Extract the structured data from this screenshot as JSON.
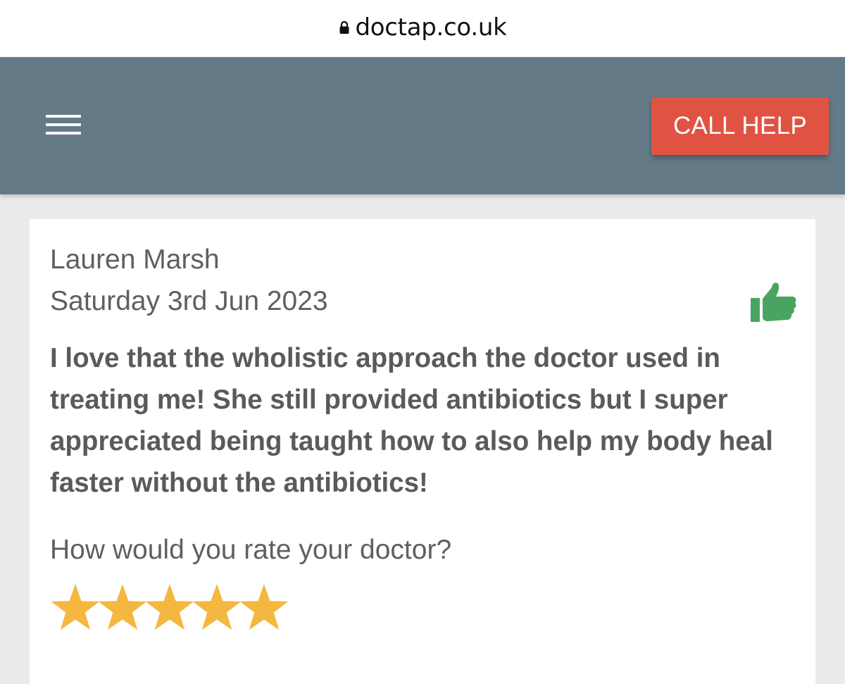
{
  "browser": {
    "url": "doctap.co.uk",
    "lock_icon": "lock-icon"
  },
  "header": {
    "menu_icon": "hamburger-menu-icon",
    "call_help_label": "CALL HELP",
    "background_color": "#647b87",
    "button_color": "#e05343"
  },
  "review": {
    "reviewer_name": "Lauren Marsh",
    "date": "Saturday 3rd Jun 2023",
    "sentiment_icon": "thumbs-up-icon",
    "sentiment_color": "#49a461",
    "text": "I love that the wholistic approach the doctor used in treating me! She still provided antibiotics but I super appreciated being taught how to also help my body heal faster without the antibiotics!",
    "rating_question": "How would you rate your doctor?",
    "rating": 5,
    "rating_max": 5,
    "star_color": "#f4b73f"
  }
}
